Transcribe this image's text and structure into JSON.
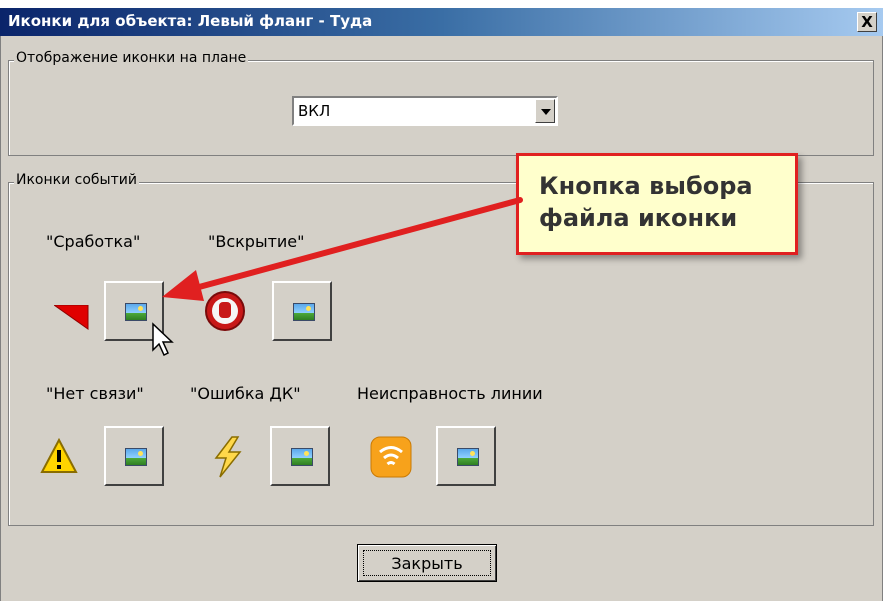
{
  "window": {
    "title": "Иконки для объекта: Левый фланг - Туда",
    "close_glyph": "X"
  },
  "display_group": {
    "label": "Отображение иконки на плане",
    "select_value": "ВКЛ"
  },
  "events_group": {
    "label": "Иконки событий",
    "events": [
      {
        "label": "\"Сработка\"",
        "icon": "red-triangle-flag-icon"
      },
      {
        "label": "\"Вскрытие\"",
        "icon": "stop-hand-icon"
      },
      {
        "label": "\"Нет связи\"",
        "icon": "warning-triangle-icon"
      },
      {
        "label": "\"Ошибка ДК\"",
        "icon": "lightning-icon"
      },
      {
        "label": "Неисправность линии",
        "icon": "signal-fault-icon"
      }
    ],
    "choose_button_icon": "image-file-icon"
  },
  "footer": {
    "close_label": "Закрыть"
  },
  "annotation": {
    "text": "Кнопка выбора\nфайла иконки",
    "color": "#e02020"
  }
}
